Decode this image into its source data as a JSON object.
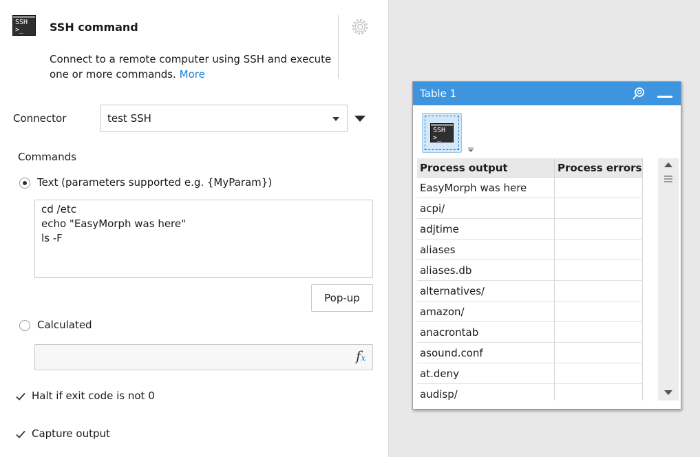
{
  "header": {
    "icon": "ssh-terminal-icon",
    "icon_text": "SSH\n>_",
    "title": "SSH command",
    "description": "Connect to a remote computer using SSH and execute one or more commands.",
    "more_link": "More",
    "settings_icon": "gear-icon"
  },
  "connector": {
    "label": "Connector",
    "value": "test SSH"
  },
  "commands": {
    "section_label": "Commands",
    "text_option_label": "Text (parameters supported e.g. {MyParam})",
    "text_option_selected": true,
    "text_value": "cd /etc\necho \"EasyMorph was here\"\nls -F",
    "popup_button": "Pop-up",
    "calculated_label": "Calculated",
    "calculated_selected": false,
    "calculated_value": "",
    "fx_icon": "fx"
  },
  "options": {
    "halt_label": "Halt if exit code is not 0",
    "halt_checked": true,
    "capture_label": "Capture output",
    "capture_checked": true
  },
  "table_window": {
    "title": "Table 1",
    "title_bg": "#3d95df",
    "pin_icon": "pin-icon",
    "minimize_icon": "minimize-icon",
    "columns": [
      "Process output",
      "Process errors"
    ],
    "rows": [
      [
        "EasyMorph was here",
        ""
      ],
      [
        "acpi/",
        ""
      ],
      [
        "adjtime",
        ""
      ],
      [
        "aliases",
        ""
      ],
      [
        "aliases.db",
        ""
      ],
      [
        "alternatives/",
        ""
      ],
      [
        "amazon/",
        ""
      ],
      [
        "anacrontab",
        ""
      ],
      [
        "asound.conf",
        ""
      ],
      [
        "at.deny",
        ""
      ],
      [
        "audisp/",
        ""
      ]
    ]
  }
}
